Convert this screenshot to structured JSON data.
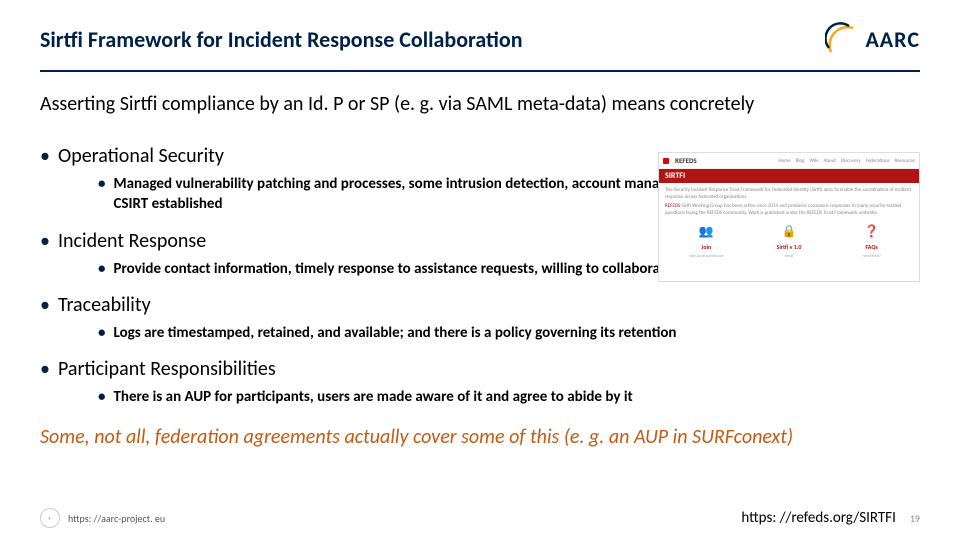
{
  "header": {
    "title": "Sirtfi Framework for Incident Response Collaboration",
    "logo_text": "AARC"
  },
  "intro": "Asserting Sirtfi compliance by an Id. P or SP (e. g. via SAML meta-data) means concretely",
  "sections": [
    {
      "heading": "Operational Security",
      "subs": [
        "Managed vulnerability patching and processes, some intrusion detection, account management,  contact information available, CSIRT established"
      ]
    },
    {
      "heading": "Incident Response",
      "subs": [
        "Provide contact information, timely response to assistance requests, willing to collaborate, respect privacy and TLP classifications"
      ]
    },
    {
      "heading": "Traceability",
      "subs": [
        "Logs are timestamped, retained, and available; and there is a policy governing its retention"
      ]
    },
    {
      "heading": "Participant Responsibilities",
      "subs": [
        "There is an AUP for participants, users are made aware of it and agree to abide by it"
      ]
    }
  ],
  "footnote": "Some, not all, federation agreements actually cover some of this (e. g. an AUP in SURFconext)",
  "footer": {
    "left_url": "https: //aarc-project. eu",
    "right_url": "https: //refeds.org/SIRTFI",
    "page": "19"
  },
  "thumb": {
    "brand": "REFEDS",
    "nav": [
      "Home",
      "Blog",
      "Wiki",
      "About",
      "Discovery",
      "Federations",
      "Resources"
    ],
    "banner": "SIRTFI",
    "line1": "The Security Incident Response Trust Framework for Federated Identity (Sirtfi) aims to enable the coordination of incident response across federated organisations.",
    "line2_a": "REFEDS",
    "line2_b": " Sirtfi Working Group has been active since 2014 and produces consensus responses to many security-related questions facing the REFEDS community. Work is published under the REFEDS Trust Framework umbrella.",
    "cards": [
      {
        "icon": "👥",
        "label": "Join",
        "sub": "Sign up to participate"
      },
      {
        "icon": "🔒",
        "label": "Sirtfi v 1.0",
        "sub": "Read"
      },
      {
        "icon": "❓",
        "label": "FAQs",
        "sub": "Need help?"
      }
    ]
  }
}
